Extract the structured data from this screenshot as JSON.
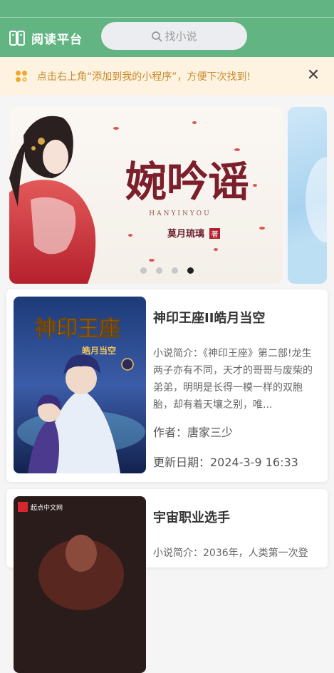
{
  "header": {
    "app_title": "阅读平台",
    "search_placeholder": "找小说",
    "brand_color": "#62b583"
  },
  "notice": {
    "text": "点击右上角“添加到我的小程序”，方便下次找到!",
    "close_icon": "close-icon"
  },
  "banner": {
    "title_art": "婉吟谣",
    "subtitle": "HANYINYOU",
    "author": "莫月琉璃",
    "author_tag": "著",
    "slide_count": 4,
    "active_slide_index": 3
  },
  "books": [
    {
      "title": "神印王座II皓月当空",
      "cover_title": "神印王座",
      "cover_subtitle": "皓月当空",
      "intro": "小说简介：《神印王座》第二部!龙生两子亦有不同，天才的哥哥与废柴的弟弟，明明是长得一模一样的双胞胎，却有着天壤之别，唯...",
      "author": "作者：唐家三少",
      "updated": "更新日期：2024-3-9 16:33"
    },
    {
      "title": "宇宙职业选手",
      "cover_badge": "起点中文网",
      "intro": "小说简介：2036年，人类第一次登"
    }
  ]
}
